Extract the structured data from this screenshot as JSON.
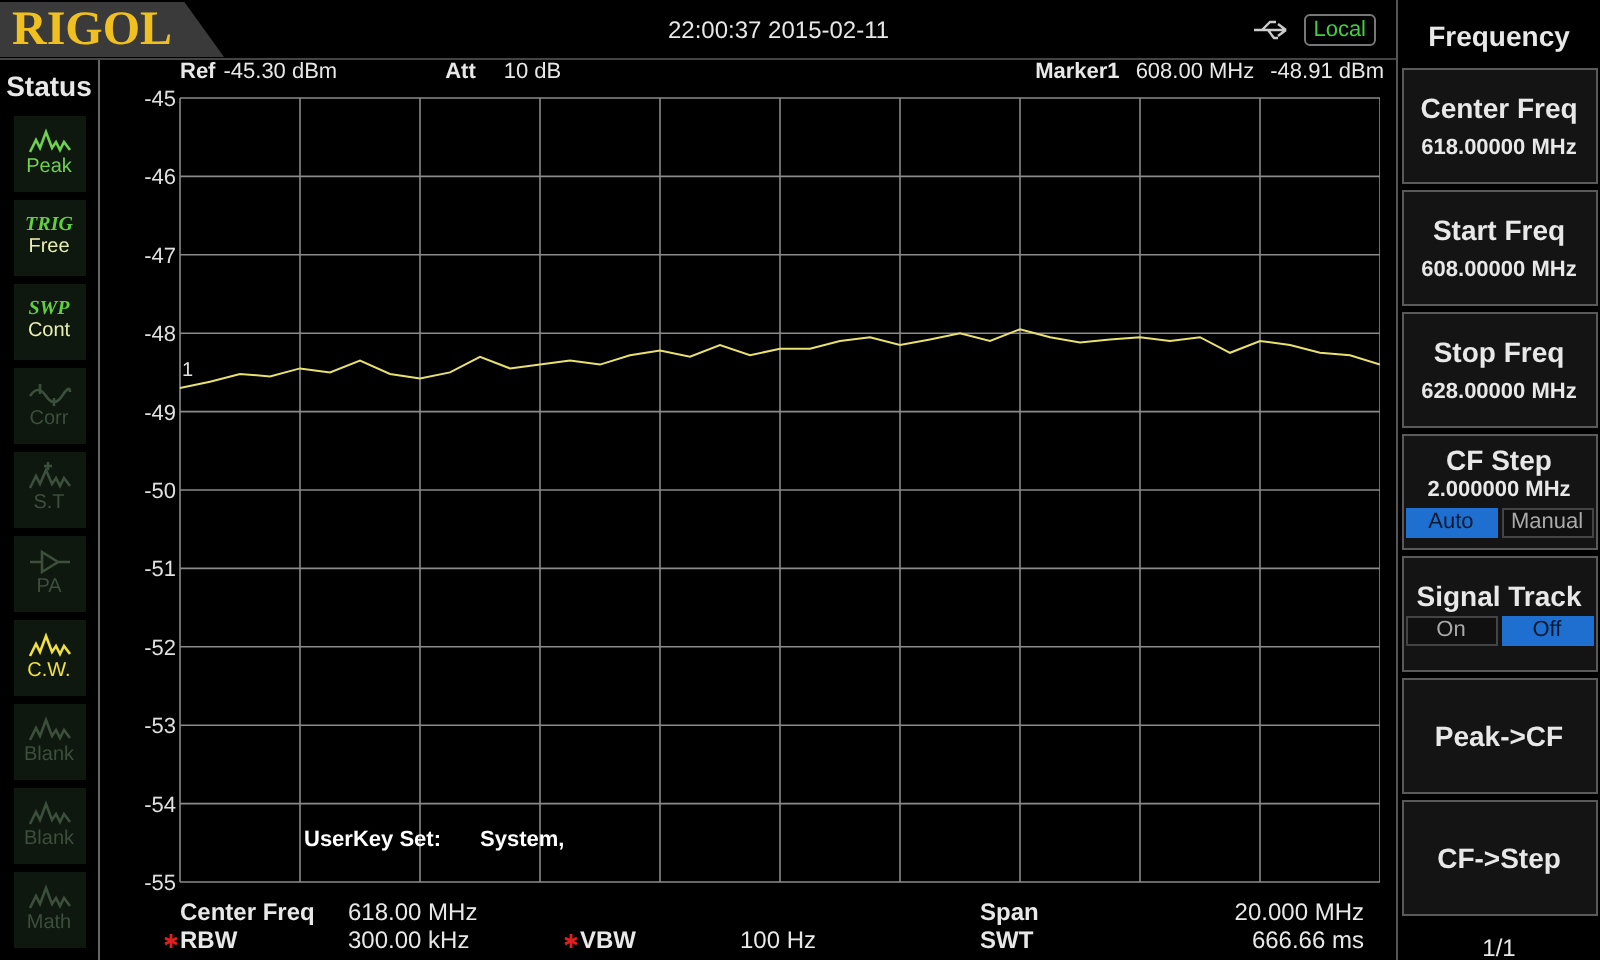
{
  "header": {
    "logo": "RIGOL",
    "datetime": "22:00:37 2015-02-11",
    "remote_badge": "Local"
  },
  "status": {
    "title": "Status",
    "items": [
      {
        "kind": "wave",
        "label": "Peak",
        "on": true
      },
      {
        "kind": "text",
        "top": "TRIG",
        "label": "Free",
        "on": true
      },
      {
        "kind": "text",
        "top": "SWP",
        "label": "Cont",
        "on": true
      },
      {
        "kind": "corr",
        "label": "Corr",
        "on": false
      },
      {
        "kind": "st",
        "label": "S.T",
        "on": false
      },
      {
        "kind": "pa",
        "label": "PA",
        "on": false
      },
      {
        "kind": "wave",
        "label": "C.W.",
        "on": true
      },
      {
        "kind": "wave",
        "label": "Blank",
        "on": false
      },
      {
        "kind": "wave",
        "label": "Blank",
        "on": false
      },
      {
        "kind": "wave",
        "label": "Math",
        "on": false
      }
    ]
  },
  "plot": {
    "ref_label": "Ref",
    "ref_value": "-45.30 dBm",
    "att_label": "Att",
    "att_value": "10 dB",
    "marker_label": "Marker1",
    "marker_freq": "608.00 MHz",
    "marker_level": "-48.91 dBm",
    "marker_tag": "1",
    "userkey_label": "UserKey Set:",
    "userkey_value": "System,",
    "chart_data": {
      "type": "line",
      "grid": true,
      "ylim": [
        -55,
        -45
      ],
      "yticks": [
        -45,
        -46,
        -47,
        -48,
        -49,
        -50,
        -51,
        -52,
        -53,
        -54,
        -55
      ],
      "series": [
        {
          "color": "#e8e070",
          "values": [
            -48.7,
            -48.62,
            -48.52,
            -48.55,
            -48.45,
            -48.5,
            -48.35,
            -48.52,
            -48.58,
            -48.5,
            -48.3,
            -48.45,
            -48.4,
            -48.35,
            -48.4,
            -48.28,
            -48.22,
            -48.3,
            -48.15,
            -48.28,
            -48.2,
            -48.2,
            -48.1,
            -48.05,
            -48.15,
            -48.08,
            -48.0,
            -48.1,
            -47.95,
            -48.05,
            -48.12,
            -48.08,
            -48.05,
            -48.1,
            -48.05,
            -48.25,
            -48.1,
            -48.15,
            -48.25,
            -48.28,
            -48.4
          ]
        }
      ]
    }
  },
  "readouts": [
    {
      "label": "Center Freq",
      "value": "618.00 MHz",
      "flagged": false
    },
    {
      "label": "RBW",
      "value": "300.00 kHz",
      "flagged": true
    },
    {
      "label": "VBW",
      "value": "100 Hz",
      "flagged": true
    },
    {
      "label": "Span",
      "value": "20.000 MHz",
      "flagged": false
    },
    {
      "label": "SWT",
      "value": "666.66 ms",
      "flagged": false
    }
  ],
  "menu": {
    "title": "Frequency",
    "page": "1/1",
    "keys": [
      {
        "kind": "value",
        "label": "Center Freq",
        "value": "618.00000 MHz"
      },
      {
        "kind": "value",
        "label": "Start Freq",
        "value": "608.00000 MHz"
      },
      {
        "kind": "value",
        "label": "Stop Freq",
        "value": "628.00000 MHz"
      },
      {
        "kind": "toggle",
        "label": "CF Step",
        "value": "2.000000 MHz",
        "options": [
          {
            "label": "Auto",
            "selected": true
          },
          {
            "label": "Manual",
            "selected": false
          }
        ]
      },
      {
        "kind": "toggle",
        "label": "Signal Track",
        "options": [
          {
            "label": "On",
            "selected": false
          },
          {
            "label": "Off",
            "selected": true
          }
        ]
      },
      {
        "kind": "action",
        "label": "Peak->CF"
      },
      {
        "kind": "action",
        "label": "CF->Step"
      }
    ]
  }
}
